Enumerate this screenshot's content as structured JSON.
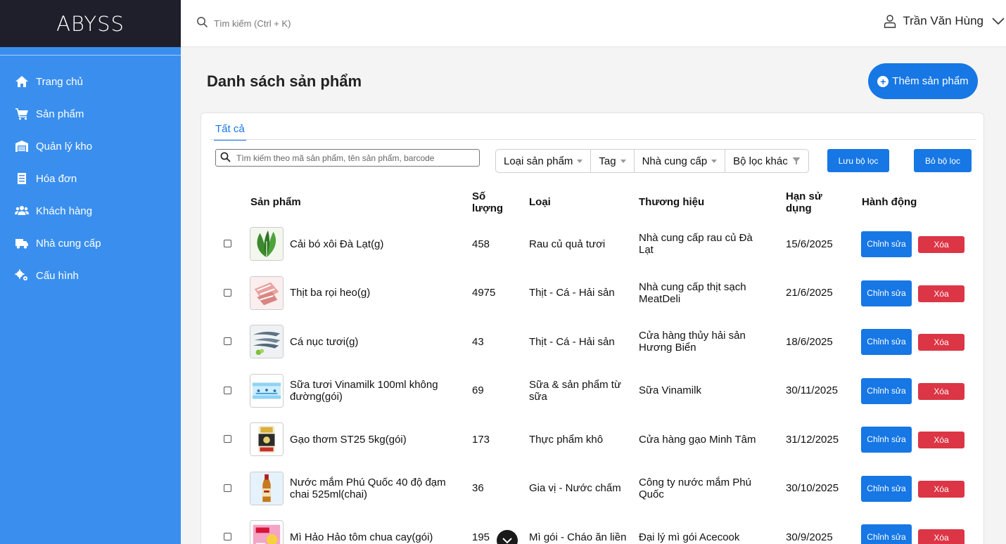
{
  "brand": {
    "name": "ABYSS"
  },
  "sidebar": {
    "items": [
      {
        "label": "Trang chủ",
        "icon": "home-icon"
      },
      {
        "label": "Sản phẩm",
        "icon": "cart-icon"
      },
      {
        "label": "Quản lý kho",
        "icon": "warehouse-icon"
      },
      {
        "label": "Hóa đơn",
        "icon": "receipt-icon"
      },
      {
        "label": "Khách hàng",
        "icon": "users-icon"
      },
      {
        "label": "Nhà cung cấp",
        "icon": "truck-icon"
      },
      {
        "label": "Cấu hình",
        "icon": "gears-icon"
      }
    ]
  },
  "topbar": {
    "search_placeholder": "Tìm kiếm (Ctrl + K)",
    "user_name": "Trần Văn Hùng"
  },
  "page": {
    "title": "Danh sách sản phẩm",
    "add_button": "Thêm sản phẩm"
  },
  "tabs": [
    {
      "label": "Tất cả",
      "active": true
    }
  ],
  "toolbar": {
    "search_placeholder": "Tìm kiếm theo mã sản phẩm, tên sản phẩm, barcode",
    "filters": [
      "Loại sản phẩm",
      "Tag",
      "Nhà cung cấp",
      "Bộ lọc khác"
    ],
    "save_filter": "Lưu bộ lọc",
    "clear_filter": "Bỏ bộ lọc"
  },
  "table": {
    "headers": {
      "product": "Sản phẩm",
      "quantity": "Số lượng",
      "category": "Loại",
      "brand": "Thương hiệu",
      "expiry": "Hạn sử dụng",
      "actions": "Hành động"
    },
    "edit_label": "Chỉnh sửa",
    "delete_label": "Xóa",
    "rows": [
      {
        "name": "Cải bó xôi Đà Lạt(g)",
        "quantity": "458",
        "category": "Rau củ quả tươi",
        "brand": "Nhà cung cấp rau củ Đà Lạt",
        "expiry": "15/6/2025"
      },
      {
        "name": "Thịt ba rọi heo(g)",
        "quantity": "4975",
        "category": "Thịt - Cá - Hải sản",
        "brand": "Nhà cung cấp thịt sạch MeatDeli",
        "expiry": "21/6/2025"
      },
      {
        "name": "Cá nục tươi(g)",
        "quantity": "43",
        "category": "Thịt - Cá - Hải sản",
        "brand": "Cửa hàng thủy hải sản Hương Biển",
        "expiry": "18/6/2025"
      },
      {
        "name": "Sữa tươi Vinamilk 100ml không đường(gói)",
        "quantity": "69",
        "category": "Sữa & sản phẩm từ sữa",
        "brand": "Sữa Vinamilk",
        "expiry": "30/11/2025"
      },
      {
        "name": "Gạo thơm ST25 5kg(gói)",
        "quantity": "173",
        "category": "Thực phẩm khô",
        "brand": "Cửa hàng gạo Minh Tâm",
        "expiry": "31/12/2025"
      },
      {
        "name": "Nước mắm Phú Quốc 40 độ đạm chai 525ml(chai)",
        "quantity": "36",
        "category": "Gia vị - Nước chấm",
        "brand": "Công ty nước mắm Phú Quốc",
        "expiry": "30/10/2025"
      },
      {
        "name": "Mì Hảo Hảo tôm chua cay(gói)",
        "quantity": "195",
        "category": "Mì gói - Cháo ăn liền",
        "brand": "Đại lý mì gói Acecook",
        "expiry": "30/9/2025"
      }
    ]
  }
}
